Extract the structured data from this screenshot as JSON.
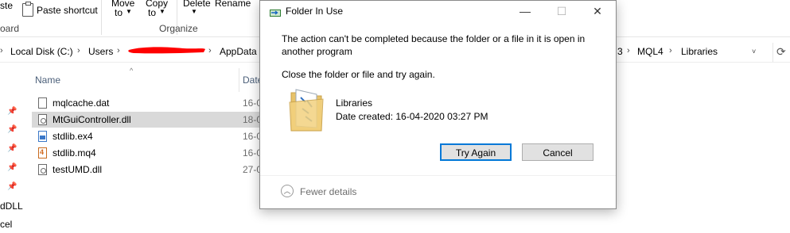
{
  "ribbon": {
    "paste_partial": "ste",
    "paste_shortcut": "Paste shortcut",
    "clipboard_partial": "oard",
    "move_to": "Move",
    "move_to_sub": "to",
    "copy_to": "Copy",
    "copy_to_sub": "to",
    "delete": "Delete",
    "rename": "Rename",
    "organize": "Organize"
  },
  "address": {
    "crumbs": [
      "Local Disk (C:)",
      "Users",
      "AppData",
      "3",
      "MQL4",
      "Libraries"
    ],
    "redaction_color": "#ff0000"
  },
  "columns": {
    "name": "Name",
    "date": "Date"
  },
  "files": [
    {
      "name": "mqlcache.dat",
      "date": "16-0",
      "type": "dat",
      "selected": false
    },
    {
      "name": "MtGuiController.dll",
      "date": "18-0",
      "type": "dll",
      "selected": true
    },
    {
      "name": "stdlib.ex4",
      "date": "16-0",
      "type": "ex4",
      "selected": false
    },
    {
      "name": "stdlib.mq4",
      "date": "16-0",
      "type": "mq4",
      "selected": false
    },
    {
      "name": "testUMD.dll",
      "date": "27-0",
      "type": "dll",
      "selected": false
    }
  ],
  "nav": {
    "item1": "dDLL",
    "item2": "cel"
  },
  "dialog": {
    "title": "Folder In Use",
    "message": "The action can't be completed because the folder or a file in it is open in another program",
    "instruction": "Close the folder or file and try again.",
    "folder_name": "Libraries",
    "date_created": "Date created: 16-04-2020 03:27 PM",
    "try_again": "Try Again",
    "cancel": "Cancel",
    "fewer_details": "Fewer details",
    "minimize_glyph": "—",
    "maximize_glyph": "☐",
    "close_glyph": "✕"
  },
  "colors": {
    "primary_button_border": "#0078d7",
    "selected_row": "#d9d9d9",
    "dialog_border": "#8a8a8a"
  }
}
